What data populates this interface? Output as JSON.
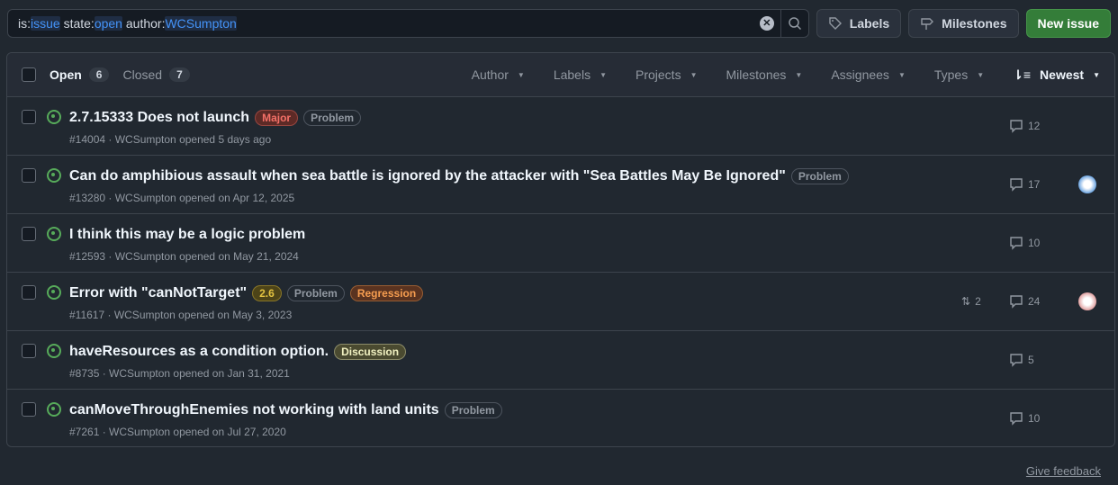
{
  "search": {
    "parts": [
      {
        "t": "is:",
        "tok": false
      },
      {
        "t": "issue",
        "tok": true
      },
      {
        "t": " state:",
        "tok": false
      },
      {
        "t": "open",
        "tok": true
      },
      {
        "t": " author:",
        "tok": false
      },
      {
        "t": "WCSumpton",
        "tok": true
      }
    ]
  },
  "toolbar": {
    "labels": "Labels",
    "milestones": "Milestones",
    "new_issue": "New issue"
  },
  "tabs": {
    "open": "Open",
    "open_count": "6",
    "closed": "Closed",
    "closed_count": "7"
  },
  "filters": [
    "Author",
    "Labels",
    "Projects",
    "Milestones",
    "Assignees",
    "Types"
  ],
  "sort": "Newest",
  "issues": [
    {
      "title": "2.7.15333 Does not launch",
      "labels": [
        {
          "name": "Major",
          "color": "#f47067",
          "bg": "#5d2a26"
        },
        {
          "name": "Problem",
          "color": "#9198a1",
          "bg": "transparent"
        }
      ],
      "meta": "#14004 · WCSumpton opened 5 days ago",
      "comments": "12",
      "prs": "",
      "avatar": ""
    },
    {
      "title": "Can do amphibious assault when sea battle is ignored by the attacker with \"Sea Battles May Be Ignored\"",
      "labels": [
        {
          "name": "Problem",
          "color": "#9198a1",
          "bg": "transparent"
        }
      ],
      "meta": "#13280 · WCSumpton opened on Apr 12, 2025",
      "comments": "17",
      "prs": "",
      "avatar": "#6ca4e0"
    },
    {
      "title": "I think this may be a logic problem",
      "labels": [],
      "meta": "#12593 · WCSumpton opened on May 21, 2024",
      "comments": "10",
      "prs": "",
      "avatar": ""
    },
    {
      "title": "Error with \"canNotTarget\"",
      "labels": [
        {
          "name": "2.6",
          "color": "#e3c341",
          "bg": "#4d4418"
        },
        {
          "name": "Problem",
          "color": "#9198a1",
          "bg": "transparent"
        },
        {
          "name": "Regression",
          "color": "#f69d50",
          "bg": "#5a3320"
        }
      ],
      "meta": "#11617 · WCSumpton opened on May 3, 2023",
      "comments": "24",
      "prs": "2",
      "avatar": "#e0a0a0"
    },
    {
      "title": "haveResources as a condition option.",
      "labels": [
        {
          "name": "Discussion",
          "color": "#f0f0c0",
          "bg": "#4a4a30"
        }
      ],
      "meta": "#8735 · WCSumpton opened on Jan 31, 2021",
      "comments": "5",
      "prs": "",
      "avatar": ""
    },
    {
      "title": "canMoveThroughEnemies not working with land units",
      "labels": [
        {
          "name": "Problem",
          "color": "#9198a1",
          "bg": "transparent"
        }
      ],
      "meta": "#7261 · WCSumpton opened on Jul 27, 2020",
      "comments": "10",
      "prs": "",
      "avatar": ""
    }
  ],
  "feedback": "Give feedback"
}
